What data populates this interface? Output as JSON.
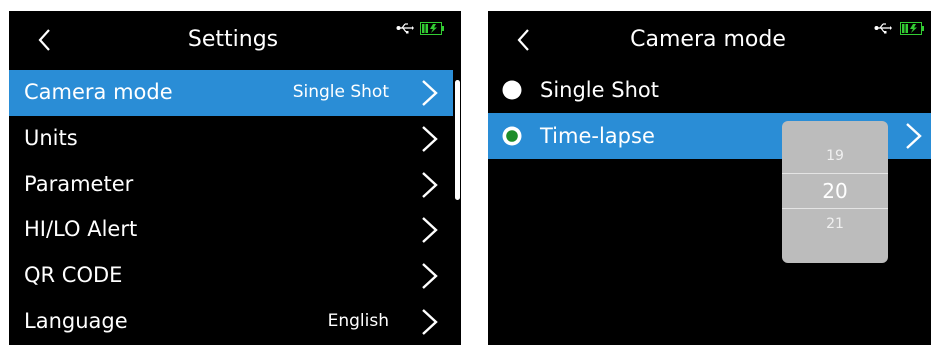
{
  "colors": {
    "accent": "#2a8dd6",
    "background": "#000000",
    "radio_checked": "#1e8c2a",
    "picker_bg": "#bcbcbc",
    "battery": "#33cc33"
  },
  "settings": {
    "title": "Settings",
    "status_icons": [
      "usb-icon",
      "battery-icon"
    ],
    "items": [
      {
        "label": "Camera mode",
        "value": "Single Shot",
        "selected": true
      },
      {
        "label": "Units",
        "value": ""
      },
      {
        "label": "Parameter",
        "value": ""
      },
      {
        "label": "HI/LO Alert",
        "value": ""
      },
      {
        "label": "QR CODE",
        "value": ""
      },
      {
        "label": "Language",
        "value": "English"
      }
    ]
  },
  "camera_mode": {
    "title": "Camera mode",
    "options": [
      {
        "label": "Single Shot",
        "checked": false,
        "selected": false
      },
      {
        "label": "Time-lapse",
        "checked": true,
        "selected": true
      }
    ],
    "picker": {
      "prev": "19",
      "current": "20",
      "next": "21"
    }
  }
}
